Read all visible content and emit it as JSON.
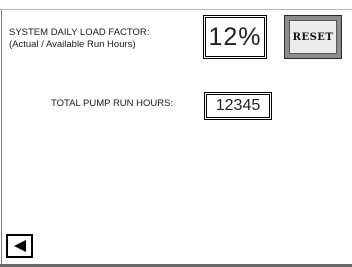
{
  "load_factor": {
    "label_line1": "SYSTEM DAILY LOAD FACTOR:",
    "label_line2": "(Actual / Available Run Hours)",
    "value": "12%"
  },
  "reset_button": {
    "label": "RESET"
  },
  "pump_run_hours": {
    "label": "TOTAL PUMP RUN HOURS:",
    "value": "12345"
  },
  "navigation": {
    "back_icon": "left-triangle-arrow"
  }
}
